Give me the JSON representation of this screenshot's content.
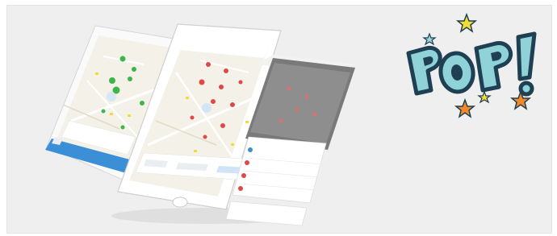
{
  "logo": {
    "text": "POP!",
    "colors": {
      "fill": "#8fd3d8",
      "outline": "#1f3f52",
      "star_yellow": "#f2dc3a",
      "star_orange": "#f0892c",
      "star_blue": "#9fd6e0"
    }
  },
  "phone_left": {
    "title": "",
    "button_label": "",
    "pin_color": "#3cb64a"
  },
  "phone_center": {
    "title": "",
    "pin_color": "#e04848"
  },
  "phone_right": {
    "sheet_rows": [
      "",
      "",
      "",
      ""
    ],
    "cancel_label": "",
    "confirm_label": ""
  },
  "colors": {
    "panel": "#efefef",
    "accent_blue": "#3a8fd6",
    "map": "#f4f2e8"
  }
}
